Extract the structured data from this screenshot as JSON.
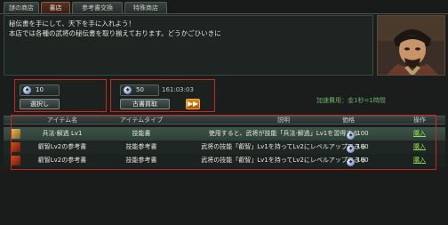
{
  "tabs": [
    {
      "label": "謎の商店",
      "active": false
    },
    {
      "label": "書店",
      "active": true
    },
    {
      "label": "参考書交換",
      "active": false
    },
    {
      "label": "特殊商店",
      "active": false
    }
  ],
  "npc": {
    "line1": "秘伝書を手にして、天下を手に入れよう！",
    "line2": "本店では各種の武将の秘伝書を取り揃えております。どうかごひいきに"
  },
  "panel_left": {
    "coin_value": "10",
    "button_label": "選択し"
  },
  "panel_right": {
    "coin_value": "50",
    "timer": "161:03:03",
    "button_label": "古書買取",
    "arrow": "▶▶"
  },
  "rate_text": "加速費用：金1秒=1時間",
  "table": {
    "headers": {
      "name": "アイテム名",
      "type": "アイテムタイプ",
      "desc": "説明",
      "price": "価格",
      "action": "操作"
    },
    "rows": [
      {
        "name": "兵法·解逃 Lv1",
        "type": "技能書",
        "desc": "使用すると、武将が技能「兵法·解逃」Lv1を習得する",
        "price": "100",
        "action": "購入"
      },
      {
        "name": "叡智Lv2の参考書",
        "type": "技能参考書",
        "desc": "武将の技能「叡智」Lv1を持ってLv2にレベルアップできる",
        "price": "100",
        "action": "購入"
      },
      {
        "name": "叡智Lv2の参考書",
        "type": "技能参考書",
        "desc": "武将の技能「叡智」Lv1を持ってLv2にレベルアップできる",
        "price": "100",
        "action": "購入"
      }
    ]
  },
  "colors": {
    "accent_red": "#c42a1e",
    "buy_green": "#8fe05a",
    "rate_green": "#6fae6a"
  }
}
